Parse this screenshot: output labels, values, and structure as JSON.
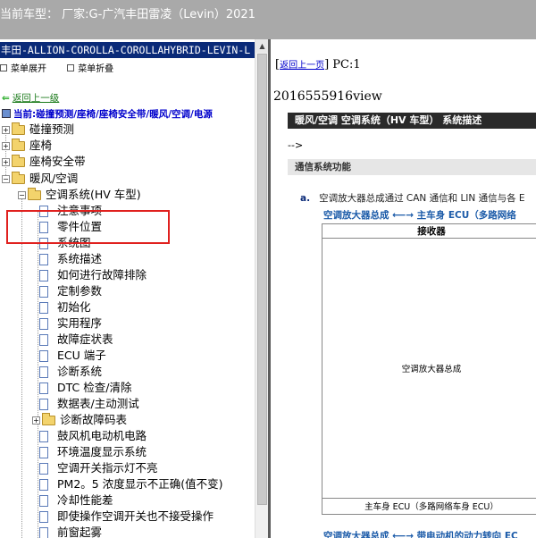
{
  "header": {
    "title": "当前车型： 厂家:G-广汽丰田雷凌（Levin）2021"
  },
  "left_panel": {
    "title": "丰田-ALLION-COROLLA-COROLLAHYBRID-LEVIN-L",
    "expand_label": "菜单展开",
    "collapse_label": "菜单折叠",
    "back_label": "返回上一级",
    "breadcrumb": "当前:碰撞预测/座椅/座椅安全带/暖风/空调/电源",
    "tree": {
      "collision": "碰撞预测",
      "seat": "座椅",
      "seatbelt": "座椅安全带",
      "hvac": "暖风/空调",
      "ac_system": "空调系统(HV 车型)",
      "items": [
        "注意事项",
        "零件位置",
        "系统图",
        "系统描述",
        "如何进行故障排除",
        "定制参数",
        "初始化",
        "实用程序",
        "故障症状表",
        "ECU 端子",
        "诊断系统",
        "DTC 检查/清除",
        "数据表/主动测试"
      ],
      "dtc_folder": "诊断故障码表",
      "items_after": [
        "鼓风机电动机电路",
        "环境温度显示系统",
        "空调开关指示灯不亮",
        "PM2。5 浓度显示不正确(值不变)",
        "冷却性能差",
        "即使操作空调开关也不接受操作",
        "前窗起雾"
      ]
    }
  },
  "right_panel": {
    "back_link": "返回上一页",
    "pc_label": "PC:1",
    "view_id": "2016555916view",
    "section_title": "暖风/空调  空调系统（HV 车型）  系统描述",
    "arrow_text": "-->",
    "subsection": "通信系统功能",
    "para_marker": "a.",
    "para_text": "空调放大器总成通过 CAN 通信和 LIN 通信与各 E",
    "blue_line_1": "空调放大器总成 ⟵→ 主车身 ECU（多路网络",
    "table": {
      "header": "接收器",
      "middle": "空调放大器总成",
      "bottom": "主车身 ECU（多路网络车身 ECU）"
    },
    "blue_line_2": "空调放大器总成 ⟵→ 带电动机的动力转向 EC"
  }
}
